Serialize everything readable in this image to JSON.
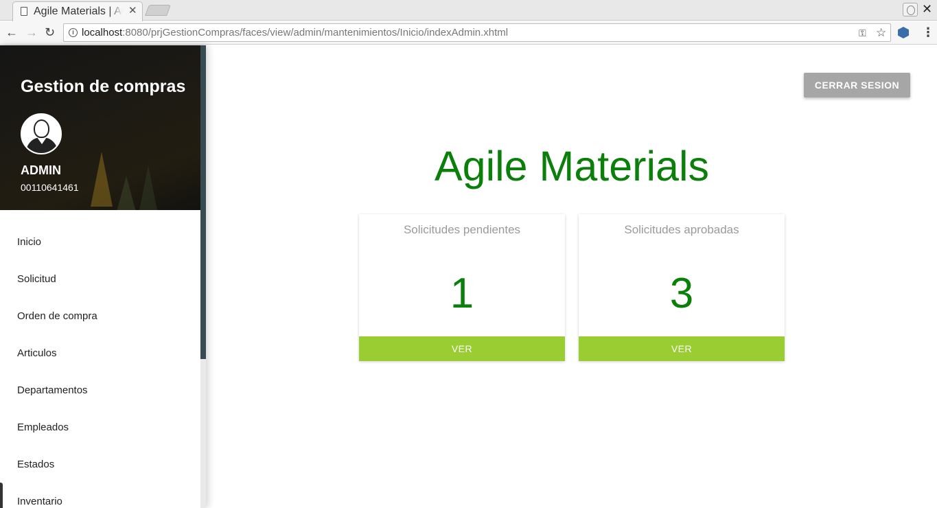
{
  "browser": {
    "tab_title": "Agile Materials | Agile Materials",
    "url_host": "localhost",
    "url_rest": ":8080/prjGestionCompras/faces/view/admin/mantenimientos/Inicio/indexAdmin.xhtml",
    "tab_close_glyph": "✕",
    "window_close_glyph": "✕",
    "nav_back_glyph": "←",
    "nav_forward_glyph": "→",
    "reload_glyph": "↻",
    "star_glyph": "☆",
    "key_glyph": "⚿",
    "menu_glyph": "⋮",
    "info_glyph": "i"
  },
  "sidebar": {
    "title": "Gestion de compras",
    "user_name": "ADMIN",
    "user_id": "00110641461",
    "items": [
      {
        "label": "Inicio"
      },
      {
        "label": "Solicitud"
      },
      {
        "label": "Orden de compra"
      },
      {
        "label": "Articulos"
      },
      {
        "label": "Departamentos"
      },
      {
        "label": "Empleados"
      },
      {
        "label": "Estados"
      },
      {
        "label": "Inventario"
      }
    ]
  },
  "main": {
    "logout_label": "CERRAR SESION",
    "title": "Agile Materials",
    "cards": [
      {
        "label": "Solicitudes pendientes",
        "value": "1",
        "button": "VER"
      },
      {
        "label": "Solicitudes aprobadas",
        "value": "3",
        "button": "VER"
      }
    ]
  },
  "colors": {
    "accent_green": "#0a7f0a",
    "button_green": "#9acd32",
    "logout_gray": "#a6a6a6",
    "scroll_thumb": "#394b52"
  }
}
